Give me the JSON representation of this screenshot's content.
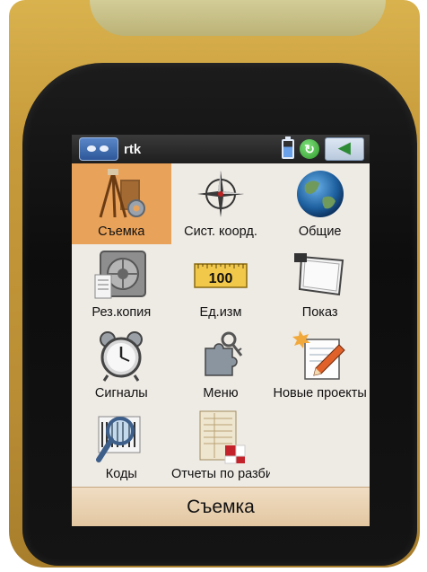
{
  "header": {
    "app_name": "rtk",
    "logo_icon": "trimble-logo-icon",
    "battery_icon": "battery-icon",
    "sync_icon": "sync-status-icon",
    "back_icon": "back-arrow-icon"
  },
  "menu": {
    "items": [
      {
        "label": "Съемка",
        "icon": "survey-tripod-icon",
        "selected": true
      },
      {
        "label": "Сист. коорд.",
        "icon": "compass-rose-icon",
        "selected": false
      },
      {
        "label": "Общие",
        "icon": "globe-icon",
        "selected": false
      },
      {
        "label": "Рез.копия",
        "icon": "vault-backup-icon",
        "selected": false
      },
      {
        "label": "Ед.изм",
        "icon": "ruler-units-icon",
        "value": "100",
        "selected": false
      },
      {
        "label": "Показ",
        "icon": "display-screen-icon",
        "selected": false
      },
      {
        "label": "Сигналы",
        "icon": "alarm-clock-icon",
        "selected": false
      },
      {
        "label": "Меню",
        "icon": "puzzle-key-icon",
        "selected": false
      },
      {
        "label": "Новые проекты",
        "icon": "new-project-pencil-icon",
        "selected": false
      },
      {
        "label": "Коды",
        "icon": "codes-magnifier-icon",
        "selected": false
      },
      {
        "label": "Отчеты по разбивке",
        "icon": "stakeout-report-icon",
        "selected": false
      }
    ]
  },
  "footer": {
    "title": "Съемка"
  },
  "colors": {
    "selected_bg": "#e9a25a",
    "screen_bg": "#eeeae4",
    "titlebar_bg": "#2a2a2a",
    "device_body": "#c79a3a"
  }
}
